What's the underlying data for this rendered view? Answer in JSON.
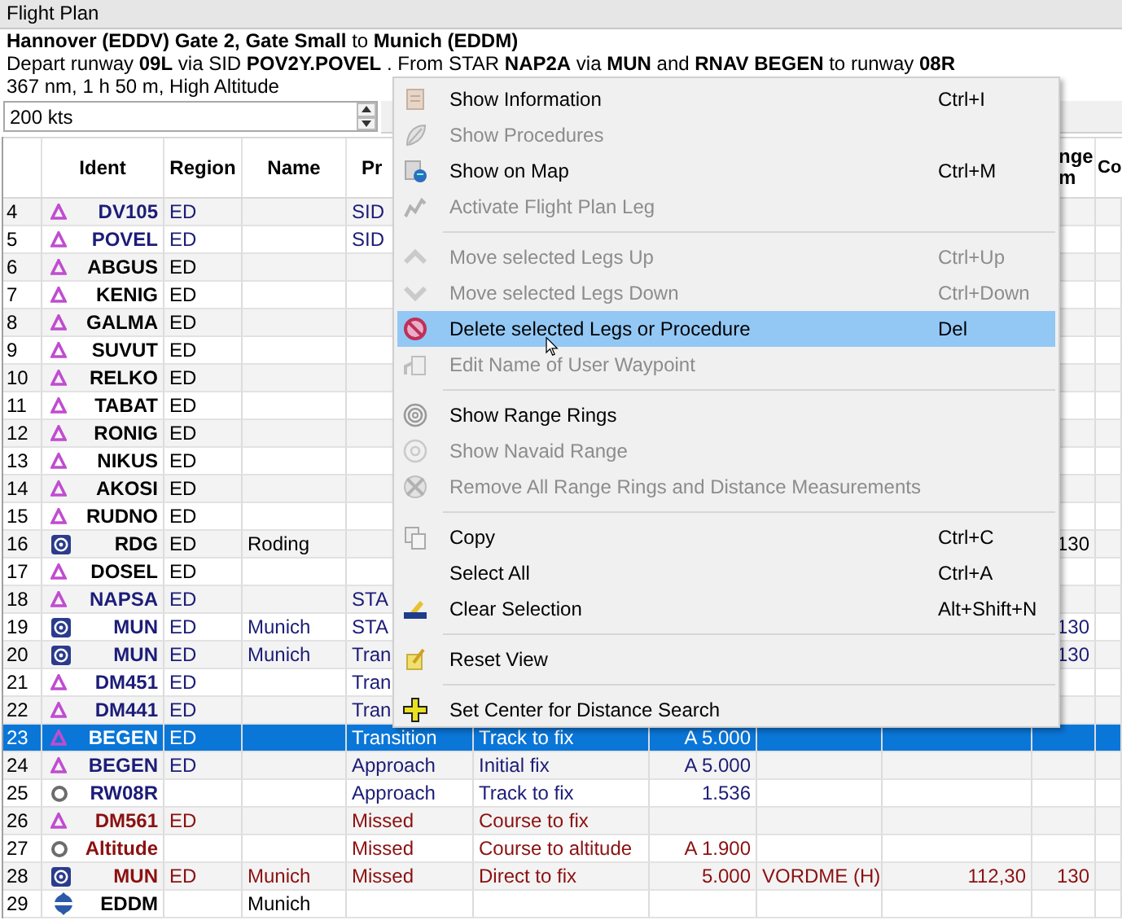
{
  "window": {
    "title": "Flight Plan"
  },
  "summary": [
    "**Hannover (EDDV) Gate 2, Gate Small** to **Munich (EDDM)**",
    "Depart runway **09L** via SID **POV2Y.POVEL** . From STAR **NAP2A** via **MUN** and **RNAV BEGEN** to runway **08R**",
    "367 nm, 1 h 50 m, High Altitude"
  ],
  "speed": {
    "value": "200 kts"
  },
  "table": {
    "columns": [
      "Ident",
      "Region",
      "Name",
      "Pr",
      "nge\nm",
      "Co"
    ],
    "rows": [
      {
        "num": "4",
        "kind": "waypoint",
        "ident": "DV105",
        "region": "ED",
        "procedure": "SID",
        "color": "#1c1c78",
        "selected": false
      },
      {
        "num": "5",
        "kind": "waypoint",
        "ident": "POVEL",
        "region": "ED",
        "procedure": "SID",
        "color": "#1c1c78",
        "selected": false
      },
      {
        "num": "6",
        "kind": "waypoint",
        "ident": "ABGUS",
        "region": "ED",
        "color": "#000000",
        "selected": false
      },
      {
        "num": "7",
        "kind": "waypoint",
        "ident": "KENIG",
        "region": "ED",
        "color": "#000000",
        "selected": false
      },
      {
        "num": "8",
        "kind": "waypoint",
        "ident": "GALMA",
        "region": "ED",
        "color": "#000000",
        "selected": false
      },
      {
        "num": "9",
        "kind": "waypoint",
        "ident": "SUVUT",
        "region": "ED",
        "color": "#000000",
        "selected": false
      },
      {
        "num": "10",
        "kind": "waypoint",
        "ident": "RELKO",
        "region": "ED",
        "color": "#000000",
        "selected": false
      },
      {
        "num": "11",
        "kind": "waypoint",
        "ident": "TABAT",
        "region": "ED",
        "color": "#000000",
        "selected": false
      },
      {
        "num": "12",
        "kind": "waypoint",
        "ident": "RONIG",
        "region": "ED",
        "color": "#000000",
        "selected": false
      },
      {
        "num": "13",
        "kind": "waypoint",
        "ident": "NIKUS",
        "region": "ED",
        "color": "#000000",
        "selected": false
      },
      {
        "num": "14",
        "kind": "waypoint",
        "ident": "AKOSI",
        "region": "ED",
        "color": "#000000",
        "selected": false
      },
      {
        "num": "15",
        "kind": "waypoint",
        "ident": "RUDNO",
        "region": "ED",
        "color": "#000000",
        "selected": false
      },
      {
        "num": "16",
        "kind": "vor",
        "ident": "RDG",
        "region": "ED",
        "name": "Roding",
        "range": "130",
        "color": "#000000",
        "selected": false
      },
      {
        "num": "17",
        "kind": "waypoint",
        "ident": "DOSEL",
        "region": "ED",
        "color": "#000000",
        "selected": false
      },
      {
        "num": "18",
        "kind": "waypoint",
        "ident": "NAPSA",
        "region": "ED",
        "procedure": "STA",
        "color": "#1c1c78",
        "selected": false
      },
      {
        "num": "19",
        "kind": "vor",
        "ident": "MUN",
        "region": "ED",
        "name": "Munich",
        "procedure": "STA",
        "range": "130",
        "color": "#1c1c78",
        "selected": false
      },
      {
        "num": "20",
        "kind": "vor",
        "ident": "MUN",
        "region": "ED",
        "name": "Munich",
        "procedure": "Tran",
        "range": "130",
        "color": "#1c1c78",
        "selected": false
      },
      {
        "num": "21",
        "kind": "waypoint",
        "ident": "DM451",
        "region": "ED",
        "procedure": "Tran",
        "color": "#1c1c78",
        "selected": false
      },
      {
        "num": "22",
        "kind": "waypoint",
        "ident": "DM441",
        "region": "ED",
        "procedure": "Tran",
        "color": "#1c1c78",
        "selected": false
      },
      {
        "num": "23",
        "kind": "waypoint",
        "ident": "BEGEN",
        "region": "ED",
        "procedure": "Transition",
        "leg": "Track to fix",
        "restriction": "A 5.000",
        "selected": true
      },
      {
        "num": "24",
        "kind": "waypoint",
        "ident": "BEGEN",
        "region": "ED",
        "procedure": "Approach",
        "leg": "Initial fix",
        "restriction": "A 5.000",
        "color": "#1c1c78",
        "selected": false
      },
      {
        "num": "25",
        "kind": "point",
        "ident": "RW08R",
        "procedure": "Approach",
        "leg": "Track to fix",
        "restriction": "1.536",
        "color": "#1c1c78",
        "selected": false
      },
      {
        "num": "26",
        "kind": "waypoint",
        "ident": "DM561",
        "region": "ED",
        "procedure": "Missed",
        "leg": "Course to fix",
        "color": "#8b1010",
        "selected": false
      },
      {
        "num": "27",
        "kind": "point",
        "ident": "Altitude",
        "procedure": "Missed",
        "leg": "Course to altitude",
        "restriction": "A 1.900",
        "color": "#8b1010",
        "selected": false
      },
      {
        "num": "28",
        "kind": "vor",
        "ident": "MUN",
        "region": "ED",
        "name": "Munich",
        "procedure": "Missed",
        "leg": "Direct to fix",
        "restriction": "5.000",
        "navaid": "VORDME (H)",
        "frequency": "112,30",
        "range": "130",
        "color": "#8b1010",
        "selected": false
      },
      {
        "num": "29",
        "kind": "airport",
        "ident": "EDDM",
        "name": "Munich",
        "color": "#000000",
        "selected": false
      }
    ]
  },
  "menu": {
    "groups": [
      {
        "items": [
          {
            "label": "Show Information",
            "shortcut": "Ctrl+I",
            "disabled": false,
            "selected": false
          },
          {
            "label": "Show Procedures",
            "disabled": true,
            "selected": false
          },
          {
            "label": "Show on Map",
            "shortcut": "Ctrl+M",
            "disabled": false,
            "selected": false
          },
          {
            "label": "Activate Flight Plan Leg",
            "disabled": true,
            "selected": false
          }
        ]
      },
      {
        "items": [
          {
            "label": "Move selected Legs Up",
            "shortcut": "Ctrl+Up",
            "disabled": true,
            "selected": false
          },
          {
            "label": "Move selected Legs Down",
            "shortcut": "Ctrl+Down",
            "disabled": true,
            "selected": false
          },
          {
            "label": "Delete selected Legs or Procedure",
            "shortcut": "Del",
            "disabled": false,
            "selected": true
          },
          {
            "label": "Edit Name of User Waypoint",
            "disabled": true,
            "selected": false
          }
        ]
      },
      {
        "items": [
          {
            "label": "Show Range Rings",
            "disabled": false,
            "selected": false
          },
          {
            "label": "Show Navaid Range",
            "disabled": true,
            "selected": false
          },
          {
            "label": "Remove All Range Rings and Distance Measurements",
            "disabled": true,
            "selected": false
          }
        ]
      },
      {
        "items": [
          {
            "label": "Copy",
            "shortcut": "Ctrl+C",
            "disabled": false,
            "selected": false
          },
          {
            "label": "Select All",
            "shortcut": "Ctrl+A",
            "disabled": false,
            "selected": false
          },
          {
            "label": "Clear Selection",
            "shortcut": "Alt+Shift+N",
            "disabled": false,
            "selected": false
          }
        ]
      },
      {
        "items": [
          {
            "label": "Reset View",
            "disabled": false,
            "selected": false
          }
        ]
      },
      {
        "items": [
          {
            "label": "Set Center for Distance Search",
            "disabled": false,
            "selected": false
          }
        ]
      }
    ]
  }
}
